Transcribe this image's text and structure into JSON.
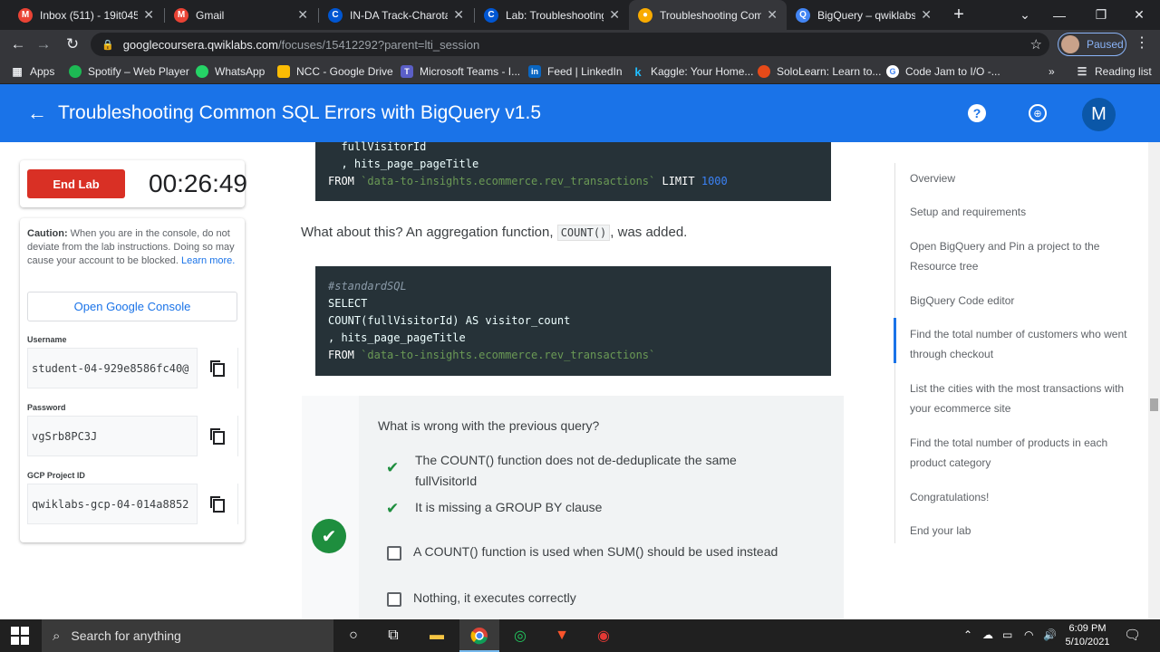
{
  "browser": {
    "tabs": [
      {
        "title": "Inbox (511) - 19it045@",
        "icon": "gmail-icon",
        "active": false
      },
      {
        "title": "Gmail",
        "icon": "gmail-icon",
        "active": false
      },
      {
        "title": "IN-DA Track-Charotar",
        "icon": "coursera-icon",
        "active": false
      },
      {
        "title": "Lab: Troubleshooting C",
        "icon": "coursera-icon",
        "active": false
      },
      {
        "title": "Troubleshooting Comm",
        "icon": "qwiklabs-icon",
        "active": true
      },
      {
        "title": "BigQuery – qwiklabs-g",
        "icon": "bigquery-icon",
        "active": false
      }
    ],
    "url_host": "googlecoursera.qwiklabs.com",
    "url_path": "/focuses/15412292?parent=lti_session",
    "profile_label": "Paused",
    "bookmarks": [
      "Apps",
      "Spotify – Web Player",
      "WhatsApp",
      "NCC - Google Drive",
      "Microsoft Teams - I...",
      "Feed | LinkedIn",
      "Kaggle: Your Home...",
      "SoloLearn: Learn to...",
      "Code Jam to I/O -..."
    ],
    "reading_list": "Reading list"
  },
  "appbar": {
    "title": "Troubleshooting Common SQL Errors with BigQuery v1.5",
    "avatar_letter": "M",
    "color": "#1a73e8"
  },
  "lab_panel": {
    "end_lab": "End Lab",
    "timer": "00:26:49",
    "caution_bold": "Caution:",
    "caution_text": " When you are in the console, do not deviate from the lab instructions. Doing so may cause your account to be blocked. ",
    "learn_more": "Learn more.",
    "open_console": "Open Google Console",
    "username_label": "Username",
    "username": "student-04-929e8586fc40@",
    "password_label": "Password",
    "password": "vgSrb8PC3J",
    "project_label": "GCP Project ID",
    "project_id": "qwiklabs-gcp-04-014a8852"
  },
  "content": {
    "code1": {
      "line1": "  fullVisitorId",
      "line2": "  , hits_page_pageTitle",
      "from": "FROM",
      "table": "`data-to-insights.ecommerce.rev_transactions`",
      "limit": "LIMIT",
      "limit_value": "1000"
    },
    "para_before": "What about this? An aggregation function, ",
    "para_code": "COUNT()",
    "para_after": ", was added.",
    "code2": {
      "comment": "#standardSQL",
      "select": "SELECT",
      "line2": "COUNT(fullVisitorId) AS visitor_count",
      "line3": ", hits_page_pageTitle",
      "from": "FROM",
      "table": "`data-to-insights.ecommerce.rev_transactions`"
    },
    "quiz": {
      "question": "What is wrong with the previous query?",
      "options": [
        {
          "text": "The COUNT() function does not de-deduplicate the same fullVisitorId",
          "checked": true
        },
        {
          "text": "It is missing a GROUP BY clause",
          "checked": true
        },
        {
          "text": "A COUNT() function is used when SUM() should be used instead",
          "checked": false
        },
        {
          "text": "Nothing, it executes correctly",
          "checked": false
        }
      ]
    }
  },
  "toc": [
    "Overview",
    "Setup and requirements",
    "Open BigQuery and Pin a project to the Resource tree",
    "BigQuery Code editor",
    "Find the total number of customers who went through checkout",
    "List the cities with the most transactions with your ecommerce site",
    "Find the total number of products in each product category",
    "Congratulations!",
    "End your lab"
  ],
  "taskbar": {
    "search_placeholder": "Search for anything",
    "time": "6:09 PM",
    "date": "5/10/2021"
  }
}
